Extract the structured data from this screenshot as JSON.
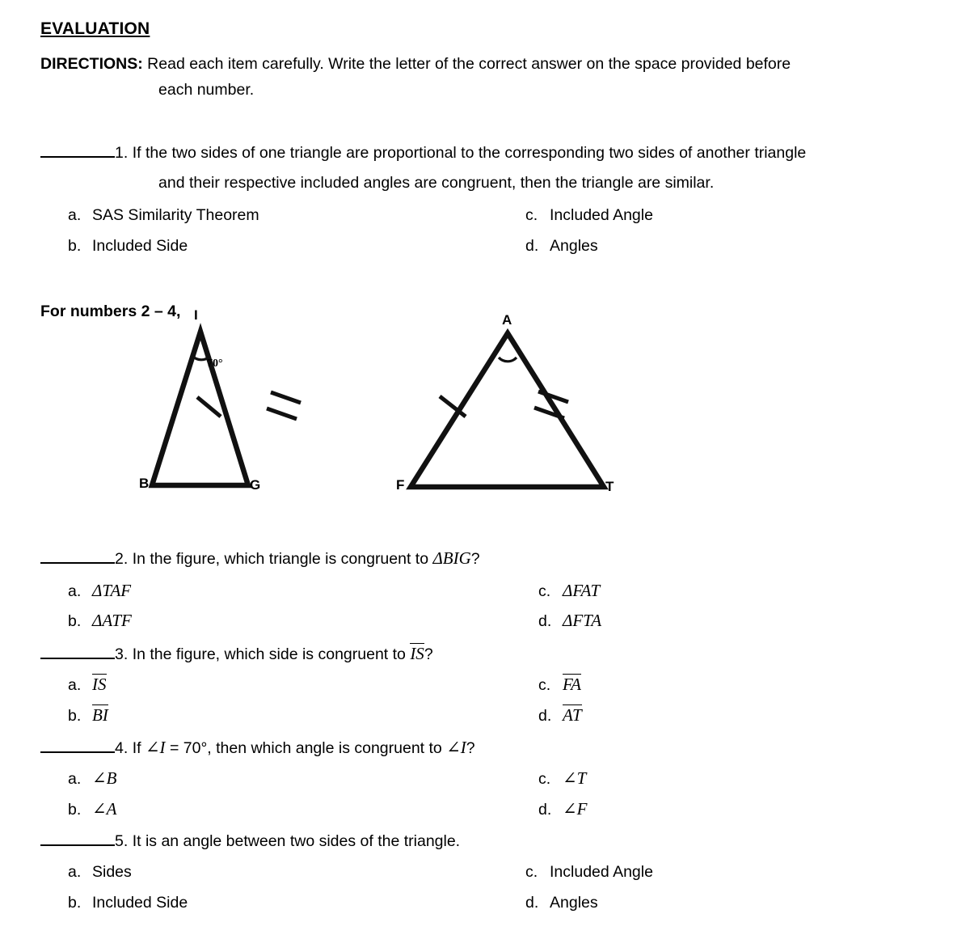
{
  "heading": {
    "title": "EVALUATION",
    "directions_label": "DIRECTIONS:",
    "directions_line1": "Read each item carefully. Write the letter of the correct answer on the space provided before",
    "directions_line2": "each number."
  },
  "figure_intro": "For numbers 2 – 4,",
  "questions": [
    {
      "number": "1.",
      "text_line1": "If the two sides of one triangle are proportional to the corresponding two sides of another triangle",
      "text_line2": "and their respective included angles are congruent, then the triangle are similar.",
      "options": {
        "a_label": "a.",
        "a_text": "SAS Similarity Theorem",
        "b_label": "b.",
        "b_text": "Included Side",
        "c_label": "c.",
        "c_text": "Included Angle",
        "d_label": "d.",
        "d_text": "Angles"
      }
    },
    {
      "number": "2.",
      "text_pre": "In the figure, which triangle is congruent to ",
      "text_math": "ΔBIG",
      "text_post": "?",
      "options": {
        "a_label": "a.",
        "a_math": "ΔTAF",
        "b_label": "b.",
        "b_math": "ΔATF",
        "c_label": "c.",
        "c_math": "ΔFAT",
        "d_label": "d.",
        "d_math": "ΔFTA"
      }
    },
    {
      "number": "3.",
      "text_pre": "In the figure, which side is congruent to ",
      "text_seg": "IS",
      "text_post": "?",
      "options": {
        "a_label": "a.",
        "a_seg": "IS",
        "b_label": "b.",
        "b_seg": "BI",
        "c_label": "c.",
        "c_seg": "FA",
        "d_label": "d.",
        "d_seg": "AT"
      }
    },
    {
      "number": "4.",
      "text_pre": "If ",
      "text_math1": "∠I",
      "text_mid": " = 70°, then which angle is congruent to ",
      "text_math2": "∠I",
      "text_post": "?",
      "options": {
        "a_label": "a.",
        "a_math": "∠B",
        "b_label": "b.",
        "b_math": "∠A",
        "c_label": "c.",
        "c_math": "∠T",
        "d_label": "d.",
        "d_math": "∠F"
      }
    },
    {
      "number": "5.",
      "text": "It is an angle between two sides of the triangle.",
      "options": {
        "a_label": "a.",
        "a_text": "Sides",
        "b_label": "b.",
        "b_text": "Included Side",
        "c_label": "c.",
        "c_text": "Included Angle",
        "d_label": "d.",
        "d_text": "Angles"
      }
    }
  ],
  "figure": {
    "triangle1": {
      "apex_label": "I",
      "left_label": "B",
      "right_label": "G",
      "angle_value": "70°",
      "left_side_ticks": 1,
      "right_side_ticks": 2
    },
    "triangle2": {
      "apex_label": "A",
      "left_label": "F",
      "right_label": "T",
      "left_side_ticks": 1,
      "right_side_ticks": 2
    },
    "stroke_color": "#000000"
  }
}
